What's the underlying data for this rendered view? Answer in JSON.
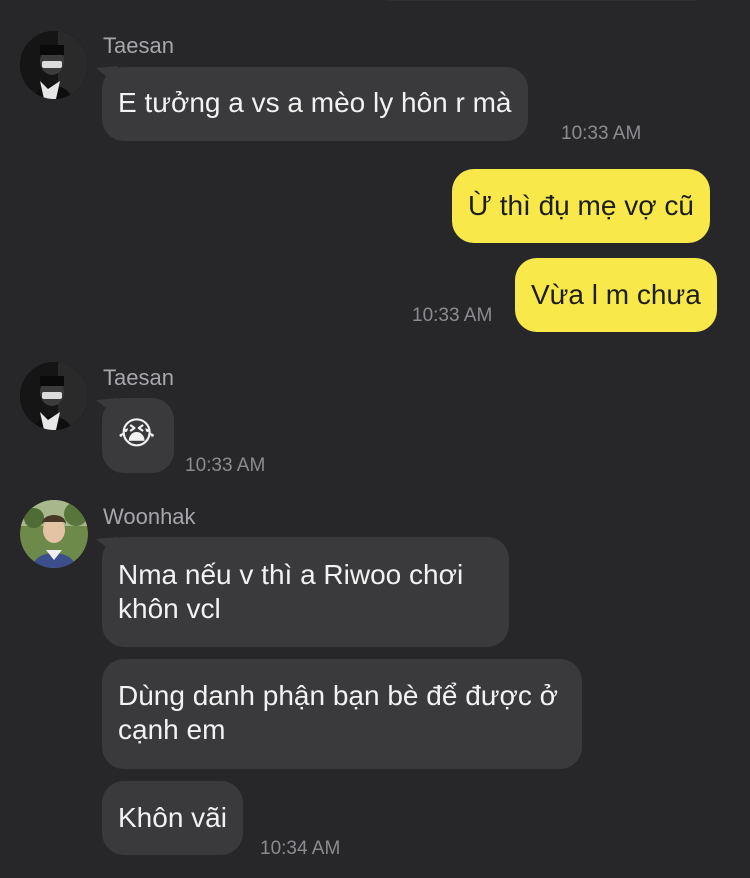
{
  "colors": {
    "background": "#27272a",
    "incoming_bubble": "#3a3a3d",
    "outgoing_bubble": "#f8e84a",
    "sender_name": "#a6a6ab",
    "timestamp": "#8b8b90"
  },
  "messages": {
    "group1": {
      "sender": "Taesan",
      "avatar_icon": "avatar-taesan",
      "text": "E tưởng a vs a mèo ly hôn r mà",
      "time": "10:33 AM"
    },
    "group2": {
      "text1": "Ừ thì đụ mẹ vợ cũ",
      "text2": "Vừa l m chưa",
      "time": "10:33 AM"
    },
    "group3": {
      "sender": "Taesan",
      "avatar_icon": "avatar-taesan",
      "emoji": "😭",
      "time": "10:33 AM"
    },
    "group4": {
      "sender": "Woonhak",
      "avatar_icon": "avatar-woonhak",
      "text1": "Nma nếu v thì a Riwoo chơi khôn vcl",
      "text2": "Dùng danh phận bạn bè để được ở cạnh em",
      "text3": "Khôn vãi",
      "time": "10:34 AM"
    }
  }
}
